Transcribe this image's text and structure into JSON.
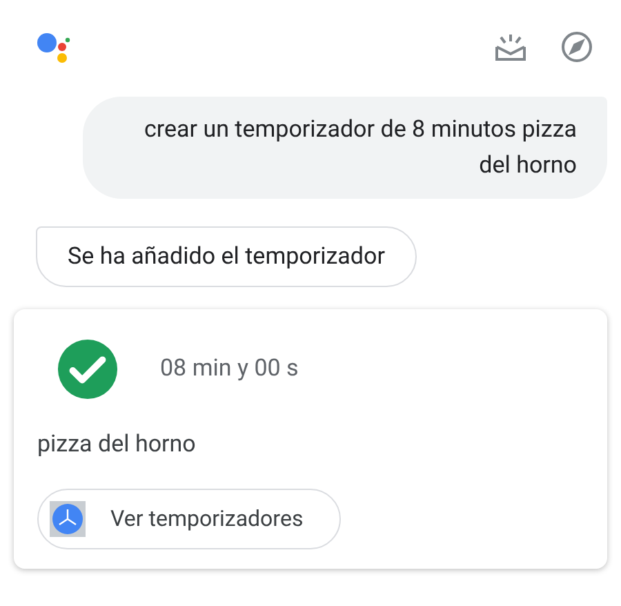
{
  "user_message": {
    "text": "crear un temporizador de 8 minutos pizza del horno"
  },
  "assistant_message": {
    "text": "Se ha añadido el temporizador"
  },
  "timer_card": {
    "completed": true,
    "duration": "08 min y 00 s",
    "label": "pizza del horno",
    "action": "Ver temporizadores"
  }
}
